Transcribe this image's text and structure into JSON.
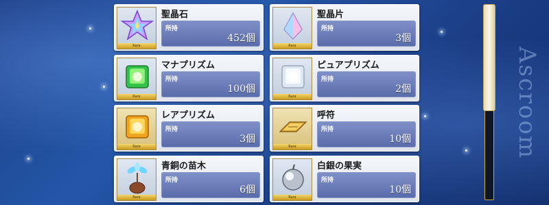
{
  "side_title": "Ascroom",
  "owned_label": "所持",
  "rarity_tag": "Rare",
  "items": [
    {
      "name": "聖晶石",
      "count": "452個",
      "icon": "saint-quartz-icon"
    },
    {
      "name": "聖晶片",
      "count": "3個",
      "icon": "quartz-fragment-icon"
    },
    {
      "name": "マナプリズム",
      "count": "100個",
      "icon": "mana-prism-icon"
    },
    {
      "name": "ピュアプリズム",
      "count": "2個",
      "icon": "pure-prism-icon"
    },
    {
      "name": "レアプリズム",
      "count": "3個",
      "icon": "rare-prism-icon"
    },
    {
      "name": "呼符",
      "count": "10個",
      "icon": "summon-ticket-icon"
    },
    {
      "name": "青銅の苗木",
      "count": "6個",
      "icon": "bronze-sapling-icon"
    },
    {
      "name": "白銀の果実",
      "count": "10個",
      "icon": "silver-apple-icon"
    }
  ]
}
